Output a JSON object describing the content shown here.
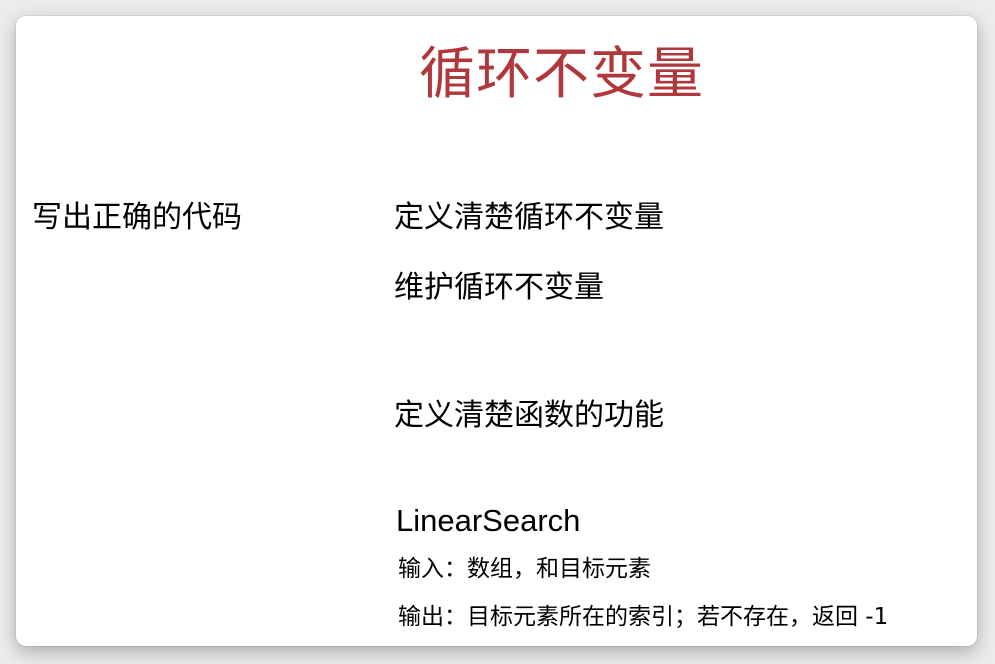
{
  "slide": {
    "title": "循环不变量",
    "side_label": "写出正确的代码",
    "points": [
      "定义清楚循环不变量",
      "维护循环不变量",
      "定义清楚函数的功能"
    ],
    "function_name": "LinearSearch",
    "details": [
      "输入：数组，和目标元素",
      "输出：目标元素所在的索引；若不存在，返回 -1"
    ],
    "colors": {
      "title": "#b0373b",
      "text": "#000000",
      "background": "#ffffff"
    }
  }
}
